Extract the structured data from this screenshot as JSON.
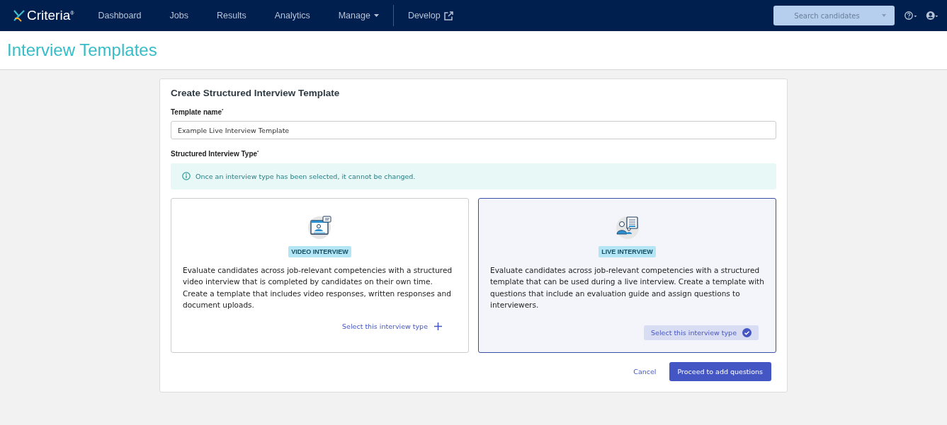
{
  "nav": {
    "logo": "Criteria$^{®}$",
    "items": [
      {
        "label": "Dashboard",
        "kind": "plain"
      },
      {
        "label": "Jobs",
        "kind": "plain"
      },
      {
        "label": "Results",
        "kind": "plain"
      },
      {
        "label": "Analytics",
        "kind": "plain"
      },
      {
        "label": "Manage",
        "kind": "dropdown"
      },
      {
        "label": "Develop",
        "kind": "external"
      }
    ],
    "search": {
      "placeholder": "Search candidates"
    }
  },
  "page_title": "Interview Templates",
  "form": {
    "title": "Create Structured Interview Template",
    "name_label": "Template name$^{*}$",
    "name_value": "Example Live Interview Template",
    "type_label": "Structured Interview Type$^{*}$",
    "notice": "Once an interview type has been selected, it cannot be changed.",
    "cards": [
      {
        "kind": "video",
        "tag": "VIDEO INTERVIEW",
        "description": "Evaluate candidates across job-relevant competencies with a structured video interview that is completed by candidates on their own time. Create a template that includes video responses, written responses and document uploads.",
        "action": "Select this interview type",
        "selected": false
      },
      {
        "kind": "live",
        "tag": "LIVE INTERVIEW",
        "description": "Evaluate candidates across job-relevant competencies with a structured template that can be used during a live interview. Create a template with questions that include an evaluation guide and assign questions to interviewers.",
        "action": "Select this interview type",
        "selected": true
      }
    ],
    "cancel": "Cancel",
    "proceed": "Proceed to add questions"
  }
}
